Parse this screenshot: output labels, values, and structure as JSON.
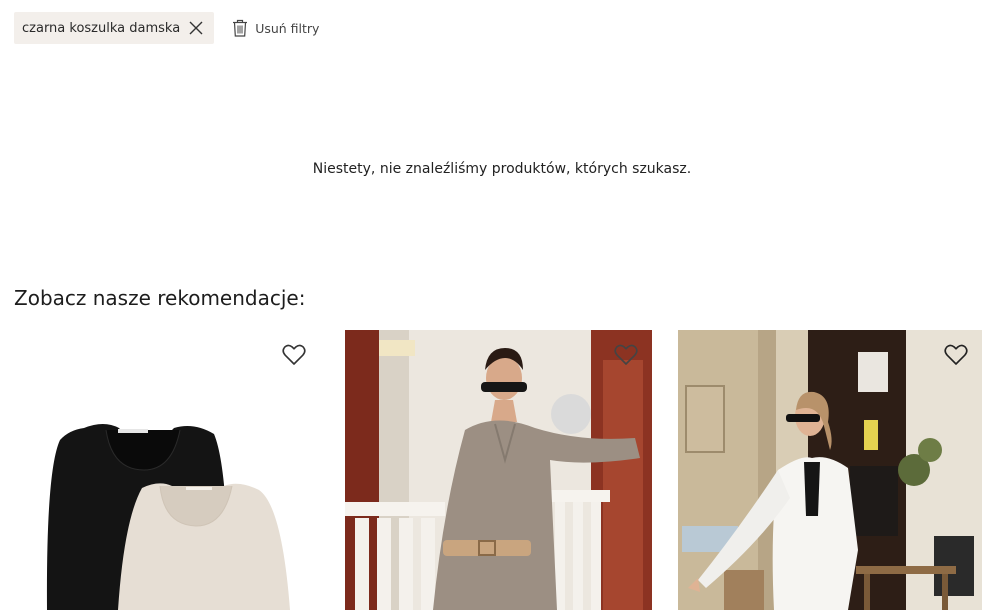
{
  "filters": {
    "active": [
      {
        "label": "czarna koszulka damska",
        "remove_icon": "close-icon"
      }
    ],
    "clear_label": "Usuń filtry",
    "clear_icon": "trash-icon"
  },
  "results": {
    "empty_message": "Niestety, nie znaleźliśmy produktów, których szukasz."
  },
  "recommendations": {
    "title": "Zobacz nasze rekomendacje:",
    "wishlist_icon": "heart-outline-icon",
    "products": [
      {
        "image": "two long-sleeve square-neck tops, black and beige"
      },
      {
        "image": "model in taupe shirt dress with belt and sunglasses"
      },
      {
        "image": "model in white blazer and trousers on a street"
      }
    ]
  },
  "colors": {
    "chip_bg": "#f3efeb",
    "text": "#222222"
  }
}
